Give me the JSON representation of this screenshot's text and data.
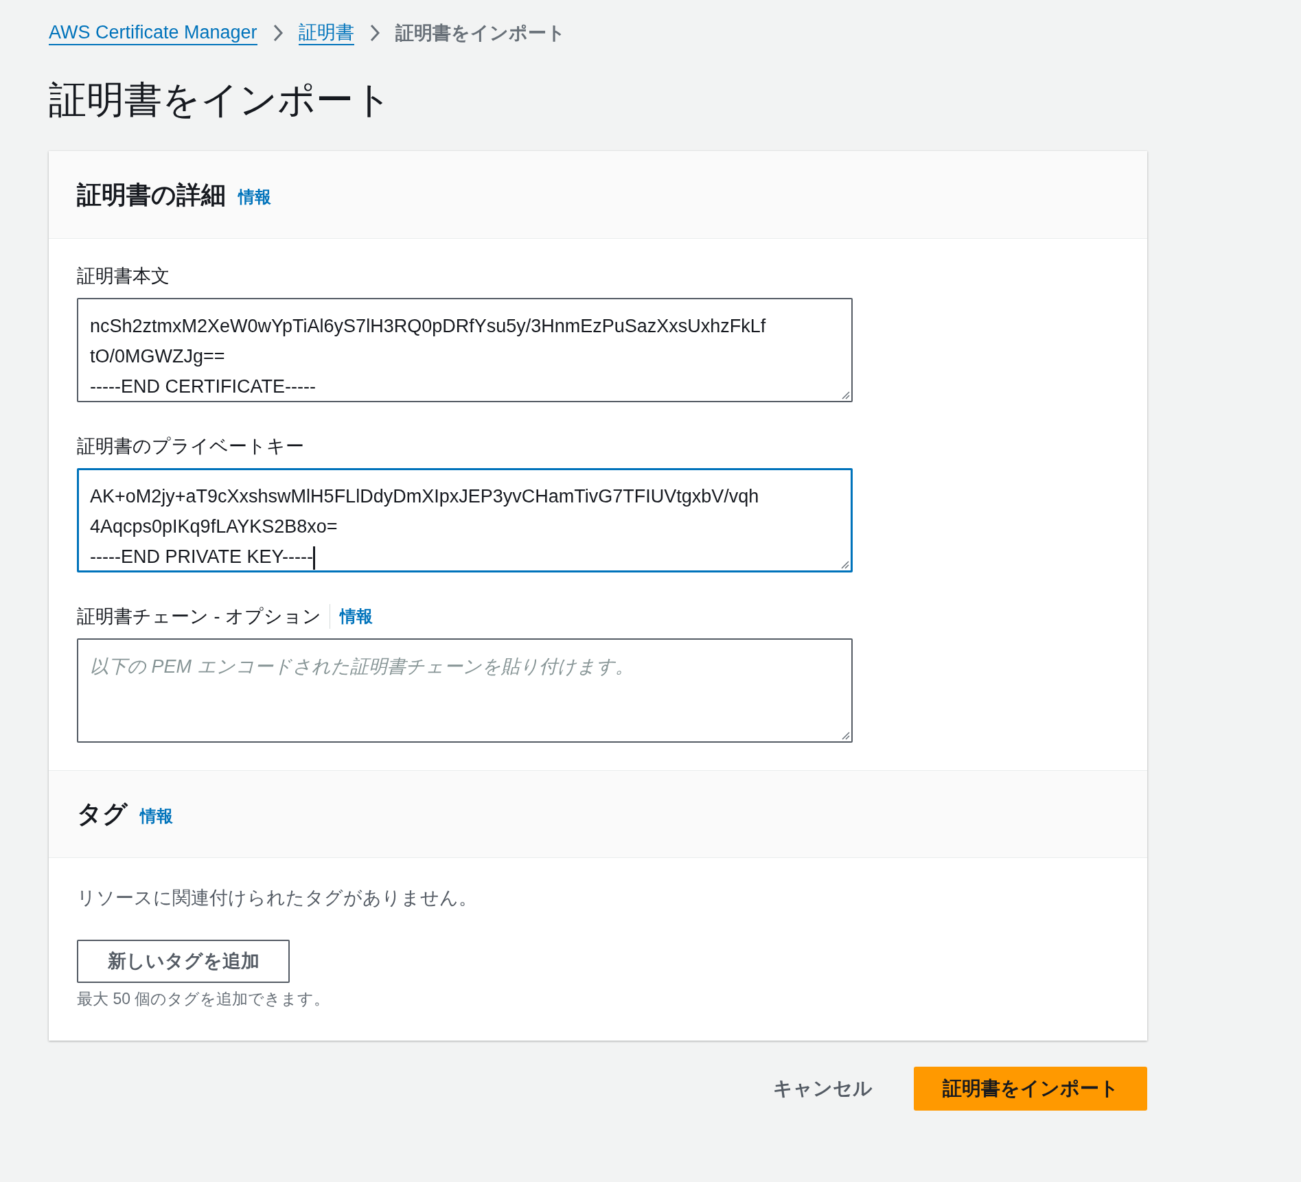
{
  "breadcrumb": [
    {
      "label": "AWS Certificate Manager",
      "link": true
    },
    {
      "label": "証明書",
      "link": true
    },
    {
      "label": "証明書をインポート",
      "link": false
    }
  ],
  "page_title": "証明書をインポート",
  "details": {
    "heading": "証明書の詳細",
    "info": "情報",
    "fields": [
      {
        "label": "証明書本文",
        "value": "ncSh2ztmxM2XeW0wYpTiAl6yS7lH3RQ0pDRfYsu5y/3HnmEzPuSazXxsUxhzFkLf\ntO/0MGWZJg==\n-----END CERTIFICATE-----",
        "focused": false
      },
      {
        "label": "証明書のプライベートキー",
        "value": "AK+oM2jy+aT9cXxshswMlH5FLlDdyDmXIpxJEP3yvCHamTivG7TFIUVtgxbV/vqh\n4Aqcps0pIKq9fLAYKS2B8xo=\n-----END PRIVATE KEY-----",
        "focused": true
      },
      {
        "label": "証明書チェーン - オプション",
        "info": "情報",
        "placeholder": "以下の PEM エンコードされた証明書チェーンを貼り付けます。",
        "focused": false
      }
    ]
  },
  "tags": {
    "heading": "タグ",
    "info": "情報",
    "empty_text": "リソースに関連付けられたタグがありません。",
    "add_button": "新しいタグを追加",
    "hint": "最大 50 個のタグを追加できます。"
  },
  "actions": {
    "cancel": "キャンセル",
    "submit": "証明書をインポート"
  }
}
